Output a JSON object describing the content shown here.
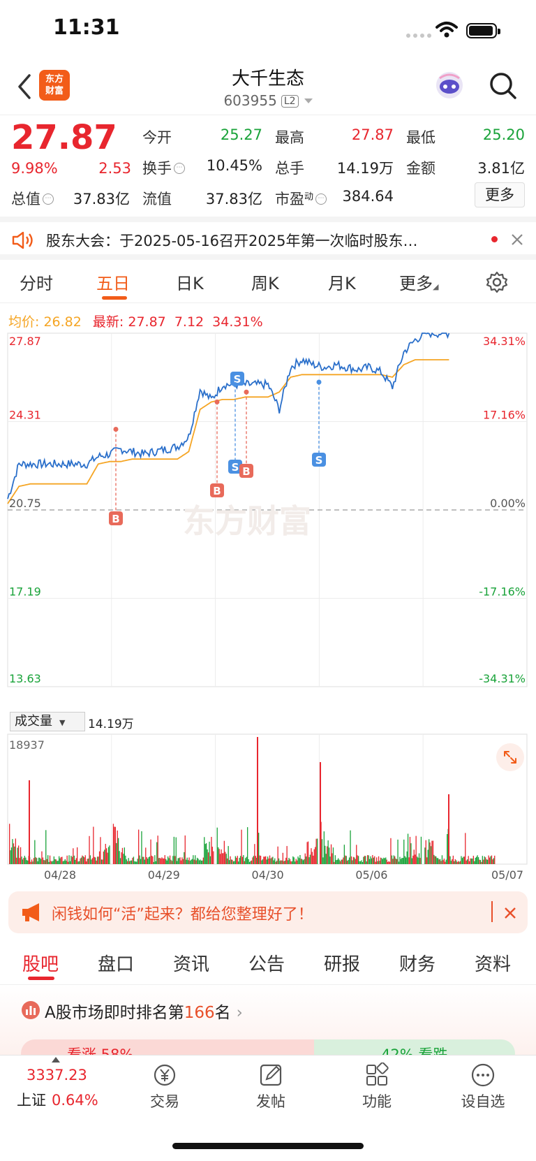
{
  "status_bar": {
    "time": "11:31"
  },
  "header": {
    "logo_text_1": "东方",
    "logo_text_2": "财富",
    "stock_name": "大千生态",
    "stock_code": "603955",
    "level_badge": "L2"
  },
  "quote": {
    "price": "27.87",
    "change_pct": "9.98%",
    "change": "2.53",
    "open_label": "今开",
    "open": "25.27",
    "high_label": "最高",
    "high": "27.87",
    "low_label": "最低",
    "low": "25.20",
    "turnover_label": "换手",
    "turnover": "10.45%",
    "volume_label": "总手",
    "volume": "14.19万",
    "amount_label": "金额",
    "amount": "3.81亿",
    "total_cap_label": "总值",
    "total_cap": "37.83亿",
    "float_cap_label": "流值",
    "float_cap": "37.83亿",
    "pe_label": "市盈",
    "pe_sup": "动",
    "pe": "384.64",
    "more_button": "更多"
  },
  "notice": {
    "text": "股东大会：于2025-05-16召开2025年第一次临时股东…"
  },
  "chart_tabs": {
    "items": [
      "分时",
      "五日",
      "日K",
      "周K",
      "月K",
      "更多"
    ],
    "active": "五日"
  },
  "chart_header": {
    "avg_label": "均价:",
    "avg_value": "26.82",
    "latest_label": "最新:",
    "latest_value": "27.87",
    "latest_change": "7.12",
    "latest_pct": "34.31%"
  },
  "chart_data": {
    "type": "line",
    "y_left_ticks": [
      "27.87",
      "24.31",
      "20.75",
      "17.19",
      "13.63"
    ],
    "y_right_ticks": [
      "34.31%",
      "17.16%",
      "0.00%",
      "-17.16%",
      "-34.31%"
    ],
    "ylim": [
      13.63,
      27.87
    ],
    "x_days": [
      "04/28",
      "04/29",
      "04/30",
      "05/06",
      "05/07"
    ],
    "series": [
      {
        "values": [
          21.2,
          22.6,
          22.6,
          22.6,
          22.6,
          22.6,
          22.6,
          22.6,
          22.9,
          23.0,
          23.2,
          23.1,
          23.0,
          23.1,
          23.2,
          23.3,
          23.7,
          25.6,
          25.2,
          25.8,
          25.8,
          25.8,
          25.8,
          25.8,
          24.8,
          26.5,
          26.8,
          26.6,
          26.5,
          26.6,
          26.5,
          26.4,
          26.5,
          26.3,
          25.7,
          27.1,
          27.6,
          27.87,
          27.87,
          27.87
        ]
      },
      {
        "values": [
          21.0,
          21.7,
          21.8,
          21.8,
          21.8,
          21.8,
          21.8,
          21.8,
          22.6,
          22.7,
          22.7,
          22.8,
          22.8,
          22.8,
          22.8,
          22.8,
          23.1,
          24.8,
          25.1,
          25.2,
          25.2,
          25.3,
          25.3,
          25.3,
          25.5,
          26.1,
          26.2,
          26.2,
          26.2,
          26.2,
          26.2,
          26.2,
          26.2,
          26.2,
          26.1,
          26.6,
          26.8,
          26.8,
          26.8,
          26.8
        ]
      }
    ],
    "markers": [
      "B",
      "B",
      "S",
      "S",
      "B",
      "S"
    ],
    "volume_label": "成交量",
    "volume_total": "14.19万",
    "volume_max": "18937"
  },
  "ad": {
    "text": "闲钱如何“活”起来？都给您整理好了！"
  },
  "info_tabs": {
    "items": [
      "股吧",
      "盘口",
      "资讯",
      "公告",
      "研报",
      "财务",
      "资料"
    ],
    "active": "股吧"
  },
  "rank": {
    "prefix": "A股市场即时排名第",
    "rank": "166",
    "suffix": "名",
    "up_label": "看涨 58%",
    "down_label": "42% 看跌"
  },
  "bottom_nav": {
    "index_value": "3337.23",
    "index_name": "上证",
    "index_pct": "0.64%",
    "items": [
      "交易",
      "发帖",
      "功能",
      "设自选"
    ]
  },
  "watermark": "东方财富",
  "colors": {
    "up": "#e8262e",
    "down": "#1aa33a",
    "price_line": "#2a6fca",
    "avg_line": "#f5a524",
    "accent": "#f25c19"
  }
}
